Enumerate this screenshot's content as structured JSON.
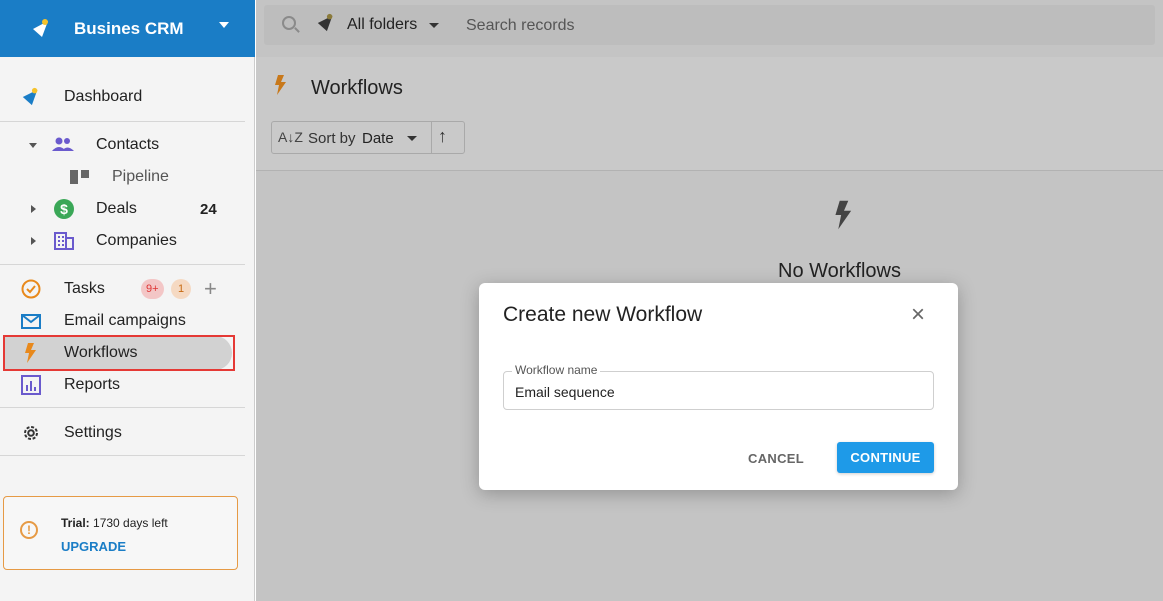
{
  "brand": {
    "name": "Busines CRM"
  },
  "topbar": {
    "folders_label": "All folders",
    "search_placeholder": "Search records"
  },
  "sidebar": {
    "items": [
      {
        "label": "Dashboard"
      },
      {
        "label": "Contacts"
      },
      {
        "label": "Pipeline"
      },
      {
        "label": "Deals",
        "count": "24"
      },
      {
        "label": "Companies"
      },
      {
        "label": "Tasks",
        "badge_red": "9+",
        "badge_orange": "1"
      },
      {
        "label": "Email campaigns"
      },
      {
        "label": "Workflows"
      },
      {
        "label": "Reports"
      },
      {
        "label": "Settings"
      }
    ],
    "trial": {
      "prefix": "Trial:",
      "text": "1730 days left",
      "upgrade_label": "UPGRADE"
    }
  },
  "page": {
    "title": "Workflows",
    "sort": {
      "label": "Sort by",
      "value": "Date"
    },
    "empty_title": "No Workflows"
  },
  "modal": {
    "title": "Create new Workflow",
    "field_label": "Workflow name",
    "field_value": "Email sequence",
    "cancel_label": "CANCEL",
    "continue_label": "CONTINUE"
  },
  "colors": {
    "brand": "#1a7dc6",
    "accent_button": "#1e9ae8",
    "workflow_icon": "#e8891c",
    "highlight_border": "#e53935"
  }
}
